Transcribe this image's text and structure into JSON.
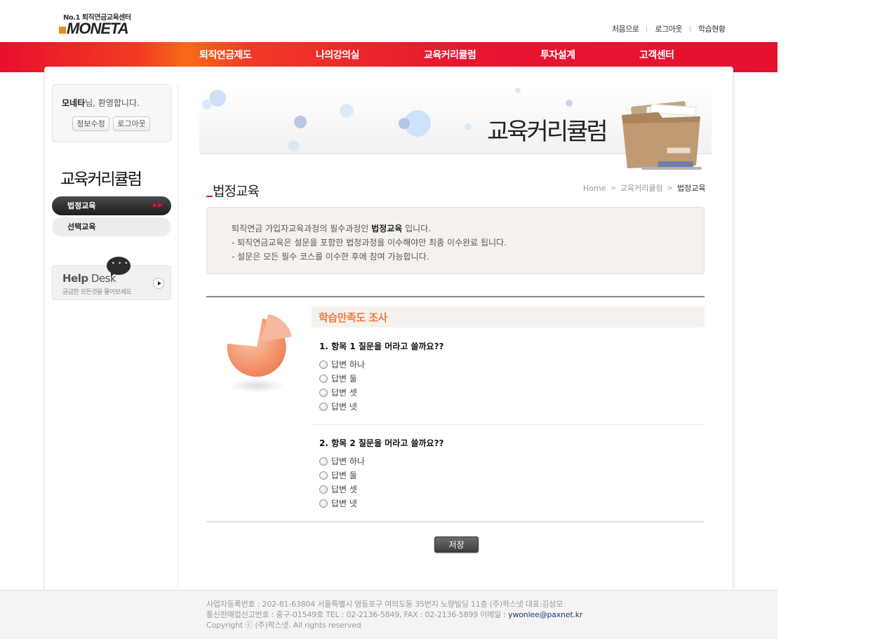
{
  "header": {
    "logo_tagline": "No.1 퇴직연금교육센터",
    "logo_text": "MONETA",
    "top_links": [
      "처음으로",
      "로그아웃",
      "학습현황"
    ]
  },
  "gnb": [
    "퇴직연금제도",
    "나의강의실",
    "교육커리큘럼",
    "투자설계",
    "고객센터"
  ],
  "sidebar": {
    "welcome_name": "모네타",
    "welcome_suffix": "님, 환영합니다.",
    "edit_info_label": "정보수정",
    "logout_label": "로그아웃",
    "section_title": "교육커리큘럼",
    "menu": [
      "법정교육",
      "선택교육"
    ],
    "helpdesk_title_bold": "Help",
    "helpdesk_title_rest": " Desk",
    "helpdesk_sub": "궁금한 모든것을 물어보세요"
  },
  "banner": {
    "title": "교육커리큘럼"
  },
  "page": {
    "title": "법정교육",
    "breadcrumb": [
      "Home",
      "교육커리큘럼",
      "법정교육"
    ]
  },
  "notice": {
    "line1_prefix": "퇴직연금 가입자교육과정의 필수과정인 ",
    "line1_bold": "법정교육",
    "line1_suffix": " 입니다.",
    "line2": "- 퇴직연금교육은 설문을 포함한 법정과정을 이수해야만 최종 이수완료 됩니다.",
    "line3": "- 설문은 모든 필수 코스를 이수한 후에 참여 가능합니다."
  },
  "survey": {
    "title": "학습만족도 조사",
    "questions": [
      {
        "text": "1. 항목 1 질문을 머라고 쓸까요??",
        "options": [
          "답변 하나",
          "답변 둘",
          "답변 셋",
          "답변 넷"
        ]
      },
      {
        "text": "2. 항목 2 질문을 머라고 쓸까요??",
        "options": [
          "답변 하나",
          "답변 둘",
          "답변 셋",
          "답변 넷"
        ]
      }
    ],
    "save_label": "저장"
  },
  "footer": {
    "line1": "사업자등록번호 : 202-81-63804 서울특별시 영등포구 여의도동 35번지 노량빌딩 11층 (주)팍스넷 대표:김성모",
    "line2_prefix": "통신판매업신고번호 : 중구-01549호 TEL : 02-2136-5849, FAX : 02-2136-5899 이메일 : ",
    "email": "ywonlee@paxnet.kr",
    "line3": "Copyright ⓒ (주)팍스넷. All rights reserved"
  },
  "colors": {
    "brand_red": "#e5112f",
    "accent_orange": "#ef7a44",
    "logo_orange": "#f08a12"
  }
}
